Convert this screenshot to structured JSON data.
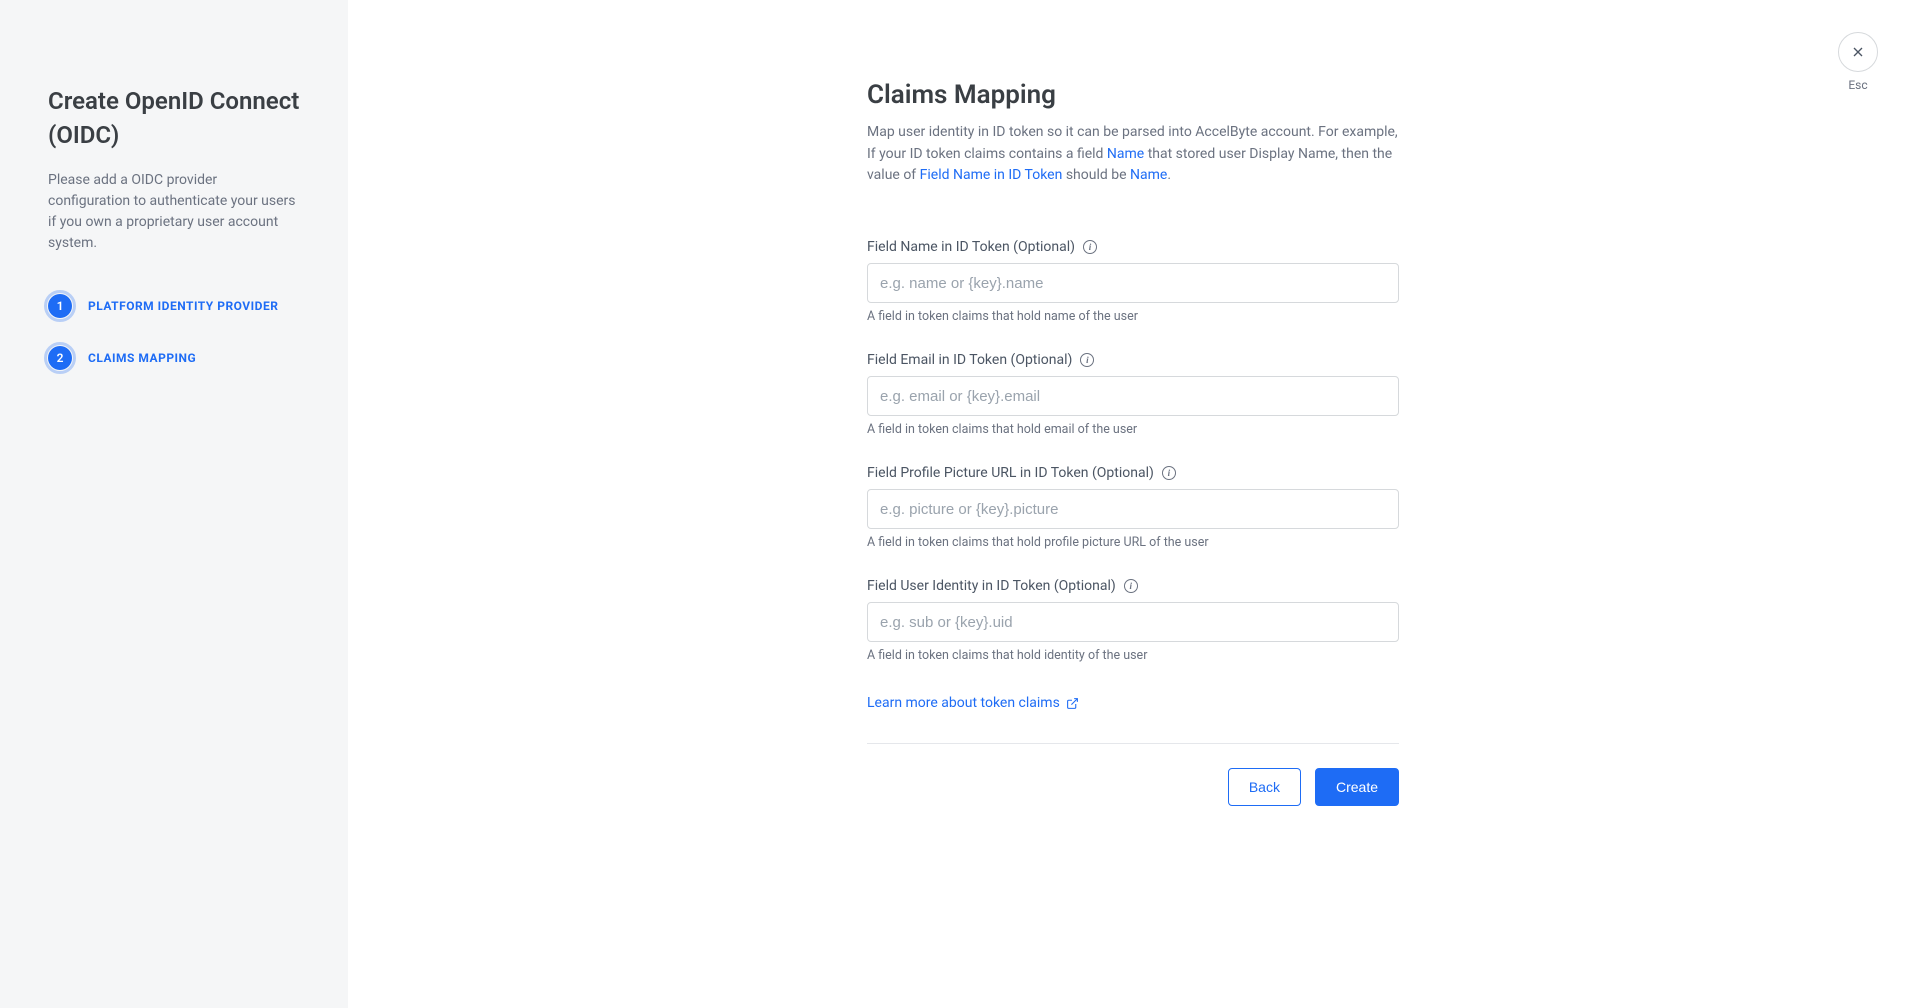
{
  "sidebar": {
    "title": "Create OpenID Connect (OIDC)",
    "description": "Please add a OIDC provider configuration to authenticate your users if you own a proprietary user account system.",
    "steps": [
      {
        "num": "1",
        "label": "PLATFORM IDENTITY PROVIDER"
      },
      {
        "num": "2",
        "label": "CLAIMS MAPPING"
      }
    ]
  },
  "close": {
    "esc": "Esc"
  },
  "main": {
    "title": "Claims Mapping",
    "desc_part1": "Map user identity in ID token so it can be parsed into AccelByte account. For example, If your ID token claims contains a field ",
    "desc_link1": "Name",
    "desc_part2": " that stored user Display Name, then the value of ",
    "desc_link2": "Field Name in ID Token",
    "desc_part3": " should be ",
    "desc_link3": "Name",
    "desc_part4": ".",
    "fields": {
      "name": {
        "label": "Field Name in ID Token (Optional)",
        "placeholder": "e.g. name or {key}.name",
        "help": "A field in token claims that hold name of the user"
      },
      "email": {
        "label": "Field Email in ID Token (Optional)",
        "placeholder": "e.g. email or {key}.email",
        "help": "A field in token claims that hold email of the user"
      },
      "picture": {
        "label": "Field Profile Picture URL in ID Token (Optional)",
        "placeholder": "e.g. picture or {key}.picture",
        "help": "A field in token claims that hold profile picture URL of the user"
      },
      "identity": {
        "label": "Field User Identity in ID Token (Optional)",
        "placeholder": "e.g. sub or {key}.uid",
        "help": "A field in token claims that hold identity of the user"
      }
    },
    "learn_link": "Learn more about token claims",
    "footer": {
      "back": "Back",
      "create": "Create"
    }
  }
}
